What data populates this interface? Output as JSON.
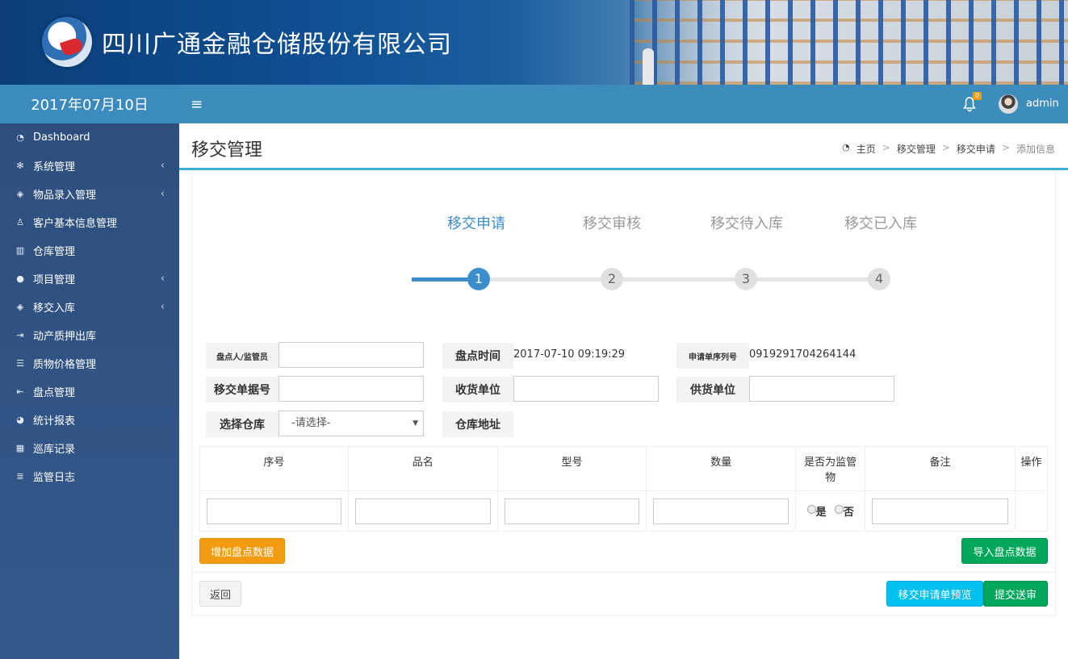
{
  "header": {
    "company_name": "四川广通金融仓储股份有限公司"
  },
  "datebar": {
    "date": "2017年07月10日"
  },
  "topbar": {
    "menu_toggle": "≡",
    "notification_count": "0",
    "username": "admin"
  },
  "sidebar": {
    "items": [
      {
        "label": "Dashboard",
        "icon": "dashboard-icon",
        "expandable": false
      },
      {
        "label": "系统管理",
        "icon": "gear-icon",
        "expandable": true
      },
      {
        "label": "物品录入管理",
        "icon": "cube-icon",
        "expandable": true
      },
      {
        "label": "客户基本信息管理",
        "icon": "male-icon",
        "expandable": false
      },
      {
        "label": "仓库管理",
        "icon": "bank-icon",
        "expandable": false
      },
      {
        "label": "项目管理",
        "icon": "users-icon",
        "expandable": true
      },
      {
        "label": "移交入库",
        "icon": "cube-icon",
        "expandable": true
      },
      {
        "label": "动产质押出库",
        "icon": "sign-out-icon",
        "expandable": false
      },
      {
        "label": "质物价格管理",
        "icon": "database-icon",
        "expandable": false
      },
      {
        "label": "盘点管理",
        "icon": "sign-in-icon",
        "expandable": false
      },
      {
        "label": "统计报表",
        "icon": "pie-chart-icon",
        "expandable": false
      },
      {
        "label": "巡库记录",
        "icon": "calendar-icon",
        "expandable": false
      },
      {
        "label": "监管日志",
        "icon": "list-icon",
        "expandable": false
      }
    ],
    "chevron": "‹"
  },
  "page": {
    "title": "移交管理"
  },
  "breadcrumb": {
    "home": "主页",
    "level1": "移交管理",
    "level2": "移交申请",
    "current": "添加信息",
    "separator": ">"
  },
  "steps": [
    {
      "label": "移交申请",
      "number": "1",
      "active": true
    },
    {
      "label": "移交审核",
      "number": "2",
      "active": false
    },
    {
      "label": "移交待入库",
      "number": "3",
      "active": false
    },
    {
      "label": "移交已入库",
      "number": "4",
      "active": false
    }
  ],
  "form": {
    "inspector_label": "盘点人/监管员",
    "inspector_value": "",
    "inventory_time_label": "盘点时间",
    "inventory_time_value": "2017-07-10 09:19:29",
    "application_serial_label": "申请单序列号",
    "application_serial_value": "0919291704264144",
    "transfer_doc_label": "移交单据号",
    "transfer_doc_value": "",
    "receiver_label": "收货单位",
    "receiver_value": "",
    "supplier_label": "供货单位",
    "supplier_value": "",
    "warehouse_select_label": "选择仓库",
    "warehouse_select_value": "-请选择-",
    "warehouse_address_label": "仓库地址"
  },
  "table": {
    "headers": [
      "序号",
      "品名",
      "型号",
      "数量",
      "是否为监管物",
      "备注",
      "操作"
    ],
    "yes_label": "是",
    "no_label": "否"
  },
  "buttons": {
    "add_inventory": "增加盘点数据",
    "import_inventory": "导入盘点数据",
    "back": "返回",
    "preview": "移交申请单预览",
    "submit": "提交送审"
  },
  "colors": {
    "primary": "#3c8dbc",
    "sidebar": "#2e4f7e",
    "step_active": "#3c8dcb",
    "orange": "#f39c12",
    "green": "#00a65a",
    "cyan": "#00c0ef"
  }
}
